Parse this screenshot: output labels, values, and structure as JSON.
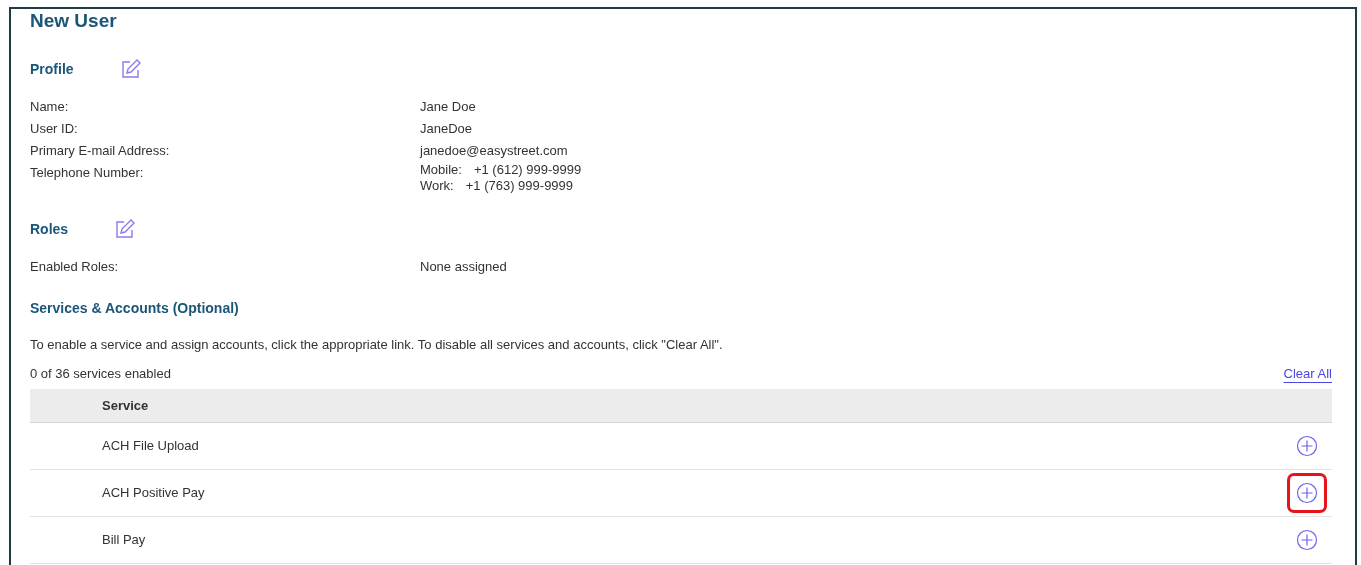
{
  "title": "New User",
  "profile": {
    "heading": "Profile",
    "fields": [
      {
        "label": "Name:",
        "values": [
          "Jane Doe"
        ]
      },
      {
        "label": "User ID:",
        "values": [
          "JaneDoe"
        ]
      },
      {
        "label": "Primary E-mail Address:",
        "values": [
          "janedoe@easystreet.com"
        ]
      },
      {
        "label": "Telephone Number:",
        "phones": [
          {
            "type": "Mobile:",
            "number": "+1 (612) 999-9999"
          },
          {
            "type": "Work:",
            "number": "+1 (763) 999-9999"
          }
        ]
      }
    ]
  },
  "roles": {
    "heading": "Roles",
    "fields": [
      {
        "label": "Enabled Roles:",
        "values": [
          "None assigned"
        ]
      }
    ]
  },
  "services": {
    "heading": "Services & Accounts (Optional)",
    "instructions": "To enable a service and assign accounts, click the appropriate link. To disable all services and accounts, click \"Clear All\".",
    "count": "0 of 36 services enabled",
    "clear_all": "Clear All",
    "table": {
      "columns": [
        "Service"
      ],
      "rows": [
        {
          "service": "ACH File Upload",
          "highlighted": false
        },
        {
          "service": "ACH Positive Pay",
          "highlighted": true
        },
        {
          "service": "Bill Pay",
          "highlighted": false
        }
      ]
    }
  }
}
